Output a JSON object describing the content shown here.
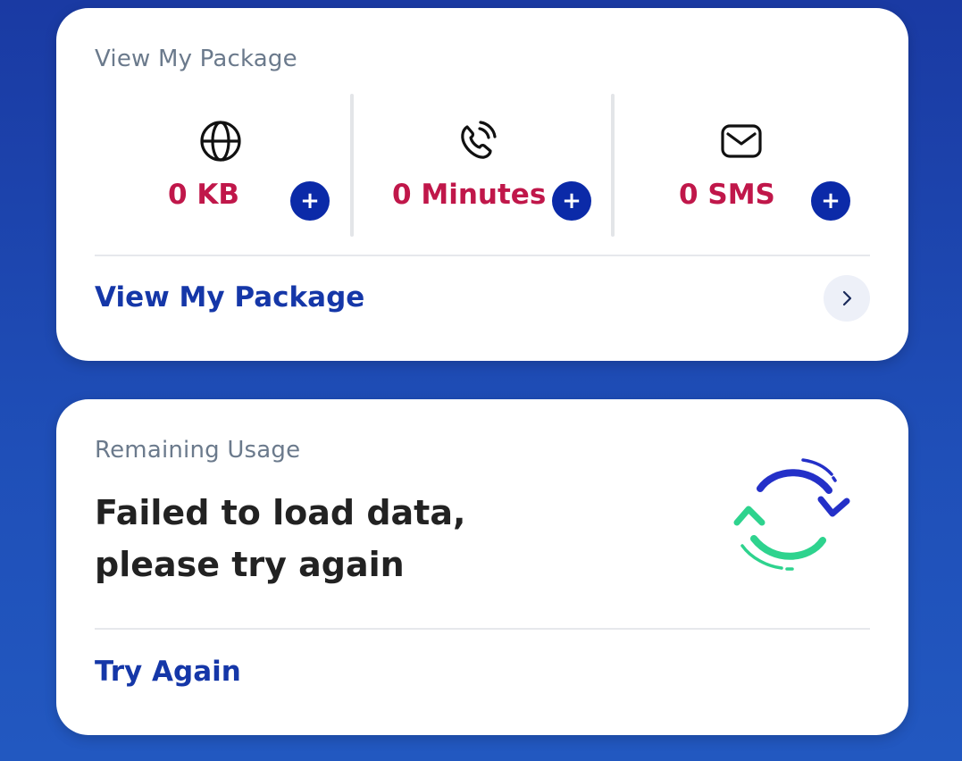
{
  "package_card": {
    "label": "View My Package",
    "stats": [
      {
        "icon": "globe-icon",
        "value": "0 KB"
      },
      {
        "icon": "phone-icon",
        "value": "0 Minutes"
      },
      {
        "icon": "envelope-icon",
        "value": "0 SMS"
      }
    ],
    "plus_label": "+",
    "link_label": "View My Package"
  },
  "usage_card": {
    "label": "Remaining Usage",
    "error_line1": "Failed to load data,",
    "error_line2": "please try again",
    "retry_label": "Try Again"
  },
  "colors": {
    "accent": "#0b2aa8",
    "value_red": "#c0174a",
    "link_blue": "#1537a8",
    "refresh_green": "#2ed38e"
  }
}
